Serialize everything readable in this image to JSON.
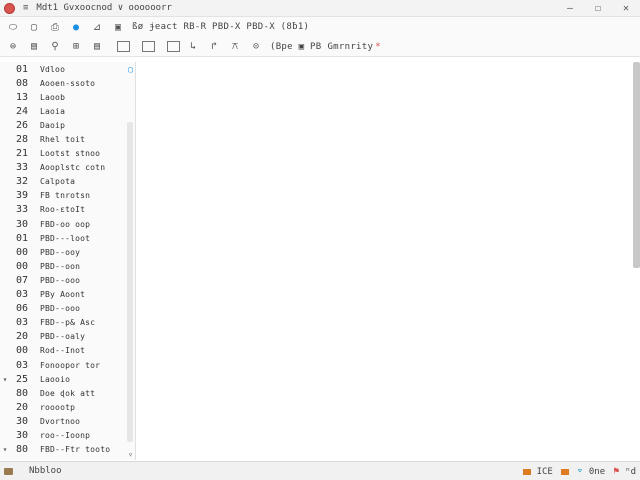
{
  "titlebar": {
    "menu_icon": "≡",
    "title": "Mdt1  Gvxoocnod  ∨  oooooorr",
    "separator": "",
    "controls": [
      "—",
      "☐",
      "✕"
    ]
  },
  "toolbar1": {
    "icons": [
      "⬭",
      "▢",
      "⎙",
      "●",
      "⊿",
      "▣"
    ],
    "icon_names": [
      "open-icon",
      "new-document-icon",
      "print-icon",
      "record-icon",
      "bookmark-icon",
      "panel-icon"
    ],
    "text": "ßø ɉeact  RB-R  PBD-X  PBD-X (8ƀ1)"
  },
  "toolbar2": {
    "icons_left": [
      "⊜",
      "▤",
      "⚲",
      "⊞",
      "▤"
    ],
    "icons_right": [
      "↳",
      "↱",
      "⚻",
      "⊙"
    ],
    "text": "(Bpe  ▣ PB",
    "status_text": "Gmrnrity",
    "red_mark": "*"
  },
  "list": {
    "top_marker": "▢",
    "bottom_marker": "▿",
    "rows": [
      {
        "marker": "",
        "num": "01",
        "label": "Vdloo"
      },
      {
        "marker": "",
        "num": "08",
        "label": "Aooen-ssoto"
      },
      {
        "marker": "",
        "num": "13",
        "label": "Laoob"
      },
      {
        "marker": "",
        "num": "24",
        "label": "Laoia"
      },
      {
        "marker": "",
        "num": "26",
        "label": "Daoip"
      },
      {
        "marker": "",
        "num": "28",
        "label": "Rhel toit"
      },
      {
        "marker": "",
        "num": "21",
        "label": "Lootst  stnoo"
      },
      {
        "marker": "",
        "num": "33",
        "label": "Aooplstc cotn"
      },
      {
        "marker": "",
        "num": "32",
        "label": "Calpota"
      },
      {
        "marker": "",
        "num": "39",
        "label": "FB  tnrotsn"
      },
      {
        "marker": "",
        "num": "33",
        "label": "Roo-ɛtoIt"
      },
      {
        "marker": "",
        "num": "30",
        "label": "FBD-oo oop"
      },
      {
        "marker": "",
        "num": "01",
        "label": "PBD---loot"
      },
      {
        "marker": "",
        "num": "00",
        "label": "PBD--ooy"
      },
      {
        "marker": "",
        "num": "00",
        "label": "PBD--oon"
      },
      {
        "marker": "",
        "num": "07",
        "label": "PBD--ooo"
      },
      {
        "marker": "",
        "num": "03",
        "label": "PBy Aoont"
      },
      {
        "marker": "",
        "num": "06",
        "label": "PBD--ooo"
      },
      {
        "marker": "",
        "num": "03",
        "label": "FBD--p& Asc"
      },
      {
        "marker": "",
        "num": "20",
        "label": "PBD--oaly"
      },
      {
        "marker": "",
        "num": "00",
        "label": "Rod--Inot"
      },
      {
        "marker": "",
        "num": "03",
        "label": "Fonoopor tor"
      },
      {
        "marker": "▾",
        "num": "25",
        "label": "Laooio"
      },
      {
        "marker": "",
        "num": "80",
        "label": "Doe  ɖok att"
      },
      {
        "marker": "",
        "num": "20",
        "label": "rooootp"
      },
      {
        "marker": "",
        "num": "30",
        "label": "Dvortnoo"
      },
      {
        "marker": "",
        "num": "30",
        "label": "roo--Ioonp"
      },
      {
        "marker": "▾",
        "num": "80",
        "label": "FBD--Ftr tooto"
      }
    ]
  },
  "statusbar": {
    "text": "Nbbloo",
    "right_texts": [
      "ICE",
      "0ne",
      "ⁿd"
    ],
    "icons": [
      "orange-square-icon",
      "orange-square-icon",
      "cyan-wifi-icon",
      "red-flag-icon"
    ]
  },
  "colors": {
    "accent": "#1a8fe3",
    "app_icon": "#d9534f",
    "status_orange": "#e07b24"
  }
}
